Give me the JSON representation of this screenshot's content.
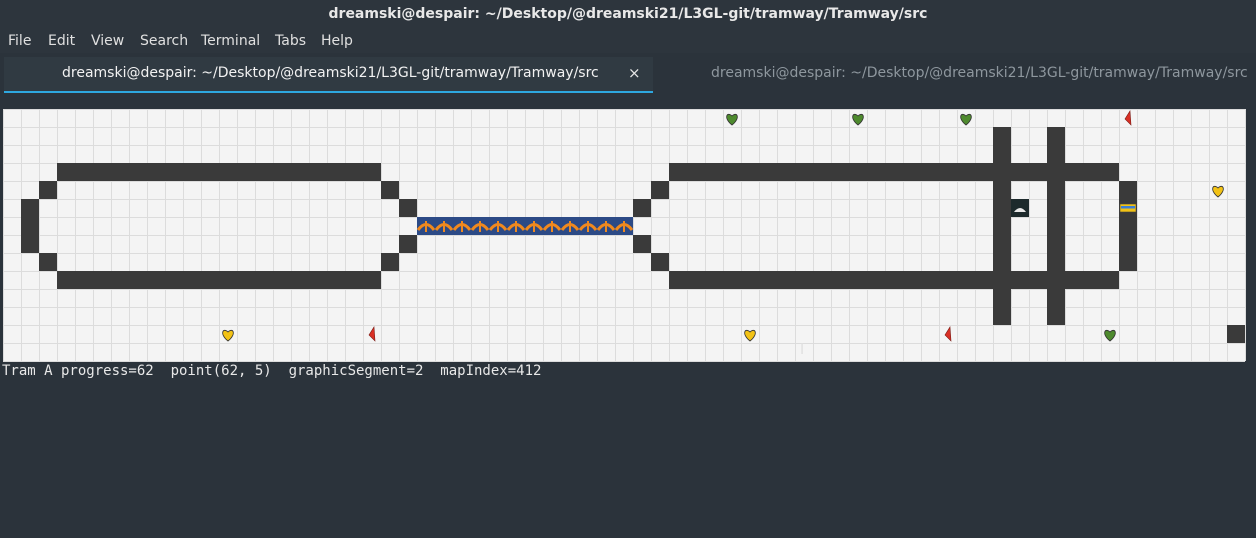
{
  "window": {
    "title": "dreamski@despair: ~/Desktop/@dreamski21/L3GL-git/tramway/Tramway/src"
  },
  "menu": {
    "items": [
      "File",
      "Edit",
      "View",
      "Search",
      "Terminal",
      "Tabs",
      "Help"
    ]
  },
  "tabs": [
    {
      "label": "dreamski@despair: ~/Desktop/@dreamski21/L3GL-git/tramway/Tramway/src",
      "active": true,
      "close_icon": "×"
    },
    {
      "label": "dreamski@despair: ~/Desktop/@dreamski21/L3GL-git/tramway/Tramway/src",
      "active": false
    }
  ],
  "map": {
    "icons": {
      "green_heart": "green-heart-icon",
      "yellow_heart": "yellow-heart-icon",
      "red_pin": "red-marker-icon",
      "bridge": "bridge-icon",
      "car": "car-icon",
      "tram": "tram-icon"
    },
    "colors": {
      "floor": "#f4f4f4",
      "grid": "#dcdcdc",
      "wall": "#3a3a3a",
      "background": "#2b333b",
      "green": "#4e8a2e",
      "yellow": "#f2c215",
      "red": "#d93025",
      "bridge_blue": "#2c4a86",
      "bridge_orange": "#f0891e",
      "tab_underline": "#2ea8e0"
    }
  },
  "status": {
    "text": "Tram A progress=62  point(62, 5)  graphicSegment=2  mapIndex=412"
  }
}
